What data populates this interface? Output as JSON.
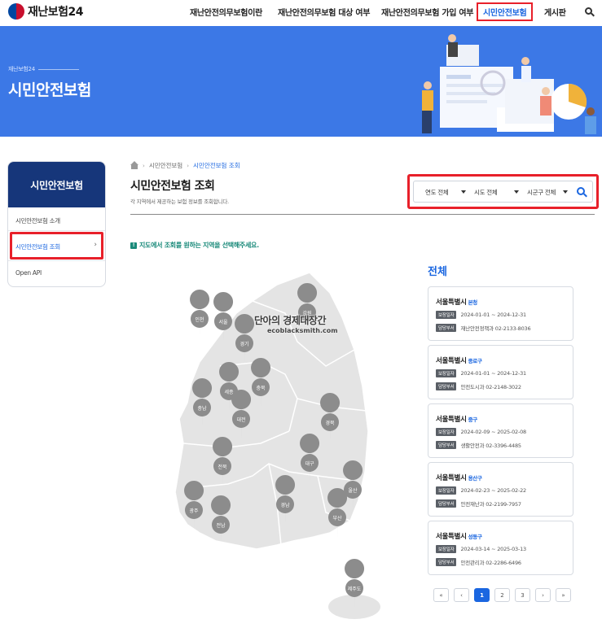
{
  "header": {
    "logo_text": "재난보험24",
    "nav": [
      {
        "label": "재난안전의무보험이란"
      },
      {
        "label": "재난안전의무보험 대상 여부"
      },
      {
        "label": "재난안전의무보험 가입 여부"
      },
      {
        "label": "시민안전보험"
      },
      {
        "label": "게시판"
      }
    ]
  },
  "hero": {
    "sub": "재난보험24",
    "title": "시민안전보험"
  },
  "sidebar": {
    "title": "시민안전보험",
    "items": [
      {
        "label": "시민안전보험 소개"
      },
      {
        "label": "시민안전보험 조회"
      },
      {
        "label": "Open API"
      }
    ]
  },
  "breadcrumb": {
    "items": [
      "시민안전보험",
      "시민안전보험 조회"
    ]
  },
  "page": {
    "title": "시민안전보험 조회",
    "desc": "각 지역에서 제공하는 보험 정보를 조회합니다."
  },
  "filters": {
    "year": "연도 전체",
    "sido": "시도 전체",
    "sigungu": "시군구 전체"
  },
  "notice": "지도에서 조회를 원하는 지역을 선택해주세요.",
  "map": {
    "regions": [
      "인천",
      "서울",
      "경기",
      "강원",
      "세종",
      "충북",
      "충남",
      "대전",
      "경북",
      "대구",
      "전북",
      "울산",
      "경남",
      "부산",
      "광주",
      "전남",
      "제주도"
    ]
  },
  "watermark": {
    "title": "단아의 경제대장간",
    "url": "ecoblacksmith.com"
  },
  "results": {
    "title": "전체",
    "period_label": "보장일자",
    "dept_label": "담당부서",
    "cards": [
      {
        "city": "서울특별시",
        "district": "본청",
        "period": "2024-01-01 ~ 2024-12-31",
        "dept": "재난안전정책과 02-2133-8036"
      },
      {
        "city": "서울특별시",
        "district": "종로구",
        "period": "2024-01-01 ~ 2024-12-31",
        "dept": "안전도시과 02-2148-3022"
      },
      {
        "city": "서울특별시",
        "district": "중구",
        "period": "2024-02-09 ~ 2025-02-08",
        "dept": "생활안전과 02-3396-4485"
      },
      {
        "city": "서울특별시",
        "district": "용산구",
        "period": "2024-02-23 ~ 2025-02-22",
        "dept": "안전재난과 02-2199-7957"
      },
      {
        "city": "서울특별시",
        "district": "성동구",
        "period": "2024-03-14 ~ 2025-03-13",
        "dept": "안전관리과 02-2286-6496"
      }
    ]
  },
  "pager": {
    "first": "«",
    "prev": "‹",
    "pages": [
      "1",
      "2",
      "3"
    ],
    "next": "›",
    "last": "»"
  },
  "colors": {
    "primary": "#1a66e0",
    "hero_bg": "#3c78e6",
    "side_head": "#16367a",
    "highlight": "#e8202a"
  }
}
